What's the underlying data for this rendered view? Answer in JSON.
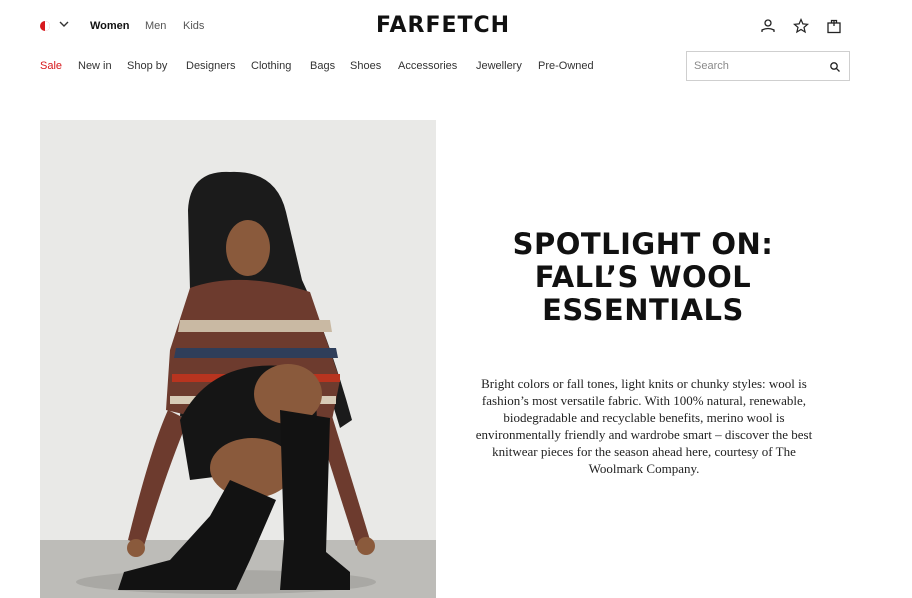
{
  "header": {
    "logo": "FARFETCH",
    "gender_tabs": [
      "Women",
      "Men",
      "Kids"
    ],
    "icons": [
      "account-icon",
      "wishlist-icon",
      "bag-icon"
    ]
  },
  "nav": {
    "items": [
      "Sale",
      "New in",
      "Shop by",
      "Designers",
      "Clothing",
      "Bags",
      "Shoes",
      "Accessories",
      "Jewellery",
      "Pre-Owned"
    ]
  },
  "search": {
    "placeholder": "Search"
  },
  "hero": {
    "headline_lines": [
      "SPOTLIGHT ON:",
      "FALL’S WOOL",
      "ESSENTIALS"
    ],
    "body": "Bright colors or fall tones, light knits or chunky styles: wool is fashion’s most versatile fabric. With 100% natural, renewable, biodegradable and recyclable benefits, merino wool is environmentally friendly and wardrobe smart – discover the best knitwear pieces for the season ahead here, courtesy of The Woolmark Company."
  },
  "colors": {
    "sale": "#d7181c",
    "text": "#222222",
    "logo": "#111111"
  }
}
